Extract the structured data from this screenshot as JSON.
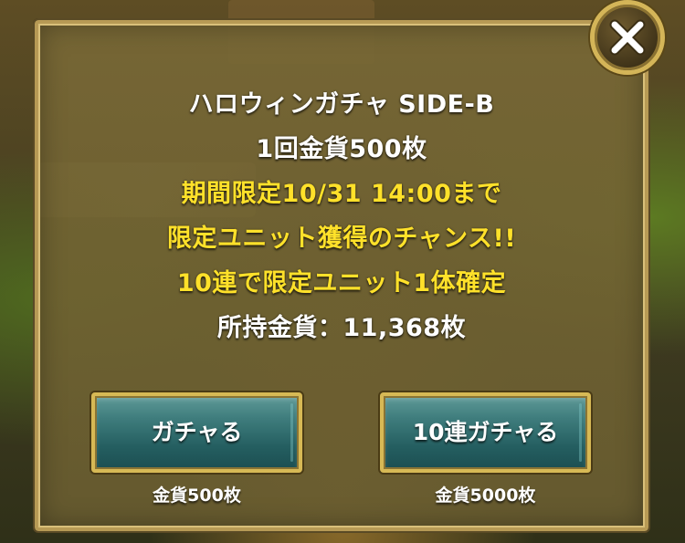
{
  "dialog": {
    "title": "ハロウィンガチャ SIDE-B",
    "price_per_pull": "1回金貨500枚",
    "period": "期間限定10/31 14:00まで",
    "promo": "限定ユニット獲得のチャンス!!",
    "guarantee": "10連で限定ユニット1体確定",
    "owned_coins": "所持金貨：11,368枚"
  },
  "buttons": {
    "single": {
      "label": "ガチャる",
      "cost": "金貨500枚"
    },
    "ten": {
      "label": "10連ガチャる",
      "cost": "金貨5000枚"
    }
  },
  "colors": {
    "highlight_text": "#ffe12a",
    "normal_text": "#ffffff",
    "button_fill": "#2a6264",
    "gold_frame": "#d7b955"
  },
  "icons": {
    "close": "close-icon"
  }
}
